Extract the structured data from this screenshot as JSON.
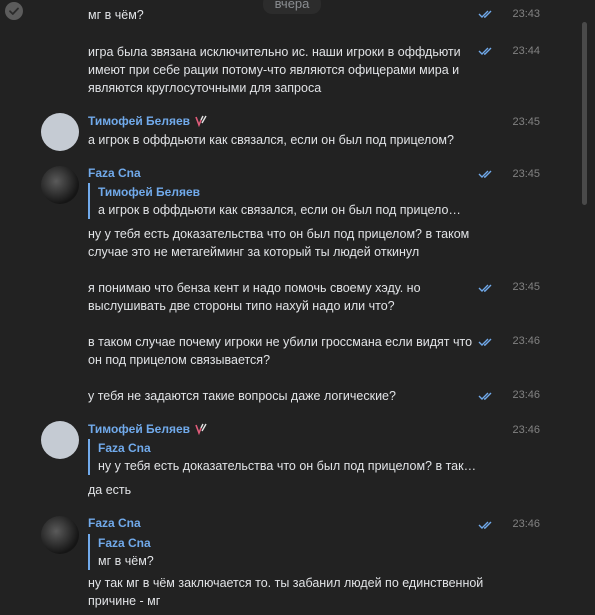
{
  "date_separator": "вчера",
  "messages": [
    {
      "id": "m1",
      "text": "мг в чём?",
      "time": "23:43",
      "read": true
    },
    {
      "id": "m2",
      "text": "игра была звязана исключительно ис. наши игроки в оффдьюти имеют при себе рации потому-что являются офицерами мира и являются круглосуточными для запроса",
      "time": "23:44",
      "read": true
    },
    {
      "id": "m3",
      "author": "Тимофей Беляев",
      "text": "а игрок в оффдьюти как связался, если он был под прицелом?",
      "time": "23:45"
    },
    {
      "id": "m4",
      "author": "Faza Cna",
      "quote": {
        "author": "Тимофей Беляев",
        "text": "а игрок в оффдьюти как связался, если он был под прицело…"
      },
      "text": "ну у тебя есть доказательства что он был под прицелом? в таком случае это не метагейминг за который ты людей откинул",
      "time": "23:45",
      "read": true
    },
    {
      "id": "m5",
      "text": "я понимаю что бенза кент и надо помочь своему хэду. но выслушивать две стороны типо нахуй надо или что?",
      "time": "23:45",
      "read": true
    },
    {
      "id": "m6",
      "text": "в таком случае почему игроки не убили гроссмана если видят что он под прицелом связывается?",
      "time": "23:46",
      "read": true
    },
    {
      "id": "m7",
      "text": "у тебя не задаются такие вопросы даже логические?",
      "time": "23:46",
      "read": true
    },
    {
      "id": "m8",
      "author": "Тимофей Беляев",
      "quote": {
        "author": "Faza Cna",
        "text": "ну у тебя есть доказательства что он был под прицелом? в так…"
      },
      "text": "да есть",
      "time": "23:46"
    },
    {
      "id": "m9",
      "author": "Faza Cna",
      "quote": {
        "author": "Faza Cna",
        "text": "мг в чём?"
      },
      "text": "ну так мг в чём заключается то. ты забанил людей по единственной причине - мг",
      "time": "23:46",
      "read": true
    }
  ],
  "colors": {
    "background": "#222222",
    "accent": "#71aaeb",
    "text": "#e1e3e6",
    "muted": "#828282"
  }
}
